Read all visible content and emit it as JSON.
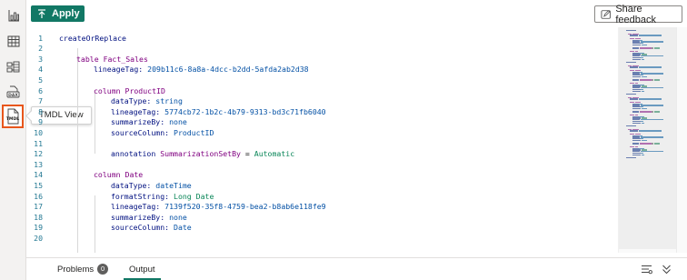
{
  "toolbar": {
    "apply_label": "Apply",
    "feedback_label": "Share feedback"
  },
  "rail": {
    "items": [
      {
        "name": "report-view",
        "icon": "bar-chart-icon"
      },
      {
        "name": "table-view",
        "icon": "table-grid-icon"
      },
      {
        "name": "model-view",
        "icon": "model-diagram-icon"
      },
      {
        "name": "dax-query-view",
        "icon": "dax-query-icon"
      },
      {
        "name": "tmdl-view",
        "icon": "tmdl-document-icon",
        "glyph": "TMDL",
        "active": true
      }
    ],
    "tooltip": "TMDL View"
  },
  "editor": {
    "lines": [
      {
        "n": "1",
        "tokens": [
          [
            "pl",
            "createOrReplace"
          ]
        ]
      },
      {
        "n": "2",
        "tokens": []
      },
      {
        "n": "3",
        "tokens": [
          [
            "txt",
            "\t"
          ],
          [
            "kw",
            "table "
          ],
          [
            "kw",
            "Fact_Sales"
          ]
        ]
      },
      {
        "n": "4",
        "tokens": [
          [
            "txt",
            "\t\t"
          ],
          [
            "pl",
            "lineageTag: "
          ],
          [
            "str",
            "209b11c6-8a8a-4dcc-b2dd-5afda2ab2d38"
          ]
        ]
      },
      {
        "n": "5",
        "tokens": []
      },
      {
        "n": "6",
        "tokens": [
          [
            "txt",
            "\t\t"
          ],
          [
            "kw",
            "column "
          ],
          [
            "kw",
            "ProductID"
          ]
        ]
      },
      {
        "n": "7",
        "tokens": [
          [
            "txt",
            "\t\t\t"
          ],
          [
            "pl",
            "dataType: "
          ],
          [
            "str",
            "string"
          ]
        ]
      },
      {
        "n": "8",
        "tokens": [
          [
            "txt",
            "\t\t\t"
          ],
          [
            "pl",
            "lineageTag: "
          ],
          [
            "str",
            "5774cb72-1b2c-4b79-9313-bd3c71fb6040"
          ]
        ]
      },
      {
        "n": "9",
        "tokens": [
          [
            "txt",
            "\t\t\t"
          ],
          [
            "pl",
            "summarizeBy: "
          ],
          [
            "str",
            "none"
          ]
        ]
      },
      {
        "n": "10",
        "tokens": [
          [
            "txt",
            "\t\t\t"
          ],
          [
            "pl",
            "sourceColumn: "
          ],
          [
            "str",
            "ProductID"
          ]
        ]
      },
      {
        "n": "11",
        "tokens": []
      },
      {
        "n": "12",
        "tokens": [
          [
            "txt",
            "\t\t\t"
          ],
          [
            "pl",
            "annotation "
          ],
          [
            "kw",
            "SummarizationSetBy"
          ],
          [
            "txt",
            " = "
          ],
          [
            "val",
            "Automatic"
          ]
        ]
      },
      {
        "n": "13",
        "tokens": []
      },
      {
        "n": "14",
        "tokens": [
          [
            "txt",
            "\t\t"
          ],
          [
            "kw",
            "column "
          ],
          [
            "kw",
            "Date"
          ]
        ]
      },
      {
        "n": "15",
        "tokens": [
          [
            "txt",
            "\t\t\t"
          ],
          [
            "pl",
            "dataType: "
          ],
          [
            "str",
            "dateTime"
          ]
        ]
      },
      {
        "n": "16",
        "tokens": [
          [
            "txt",
            "\t\t\t"
          ],
          [
            "pl",
            "formatString: "
          ],
          [
            "val",
            "Long Date"
          ]
        ]
      },
      {
        "n": "17",
        "tokens": [
          [
            "txt",
            "\t\t\t"
          ],
          [
            "pl",
            "lineageTag: "
          ],
          [
            "str",
            "7139f520-35f8-4759-bea2-b8ab6e118fe9"
          ]
        ]
      },
      {
        "n": "18",
        "tokens": [
          [
            "txt",
            "\t\t\t"
          ],
          [
            "pl",
            "summarizeBy: "
          ],
          [
            "str",
            "none"
          ]
        ]
      },
      {
        "n": "19",
        "tokens": [
          [
            "txt",
            "\t\t\t"
          ],
          [
            "pl",
            "sourceColumn: "
          ],
          [
            "str",
            "Date"
          ]
        ]
      },
      {
        "n": "20",
        "tokens": []
      }
    ]
  },
  "panel": {
    "tabs": [
      {
        "label": "Problems",
        "badge": "0",
        "active": false
      },
      {
        "label": "Output",
        "active": true
      }
    ]
  },
  "colors": {
    "accent": "#117865",
    "active_rail_border": "#e8561c"
  }
}
